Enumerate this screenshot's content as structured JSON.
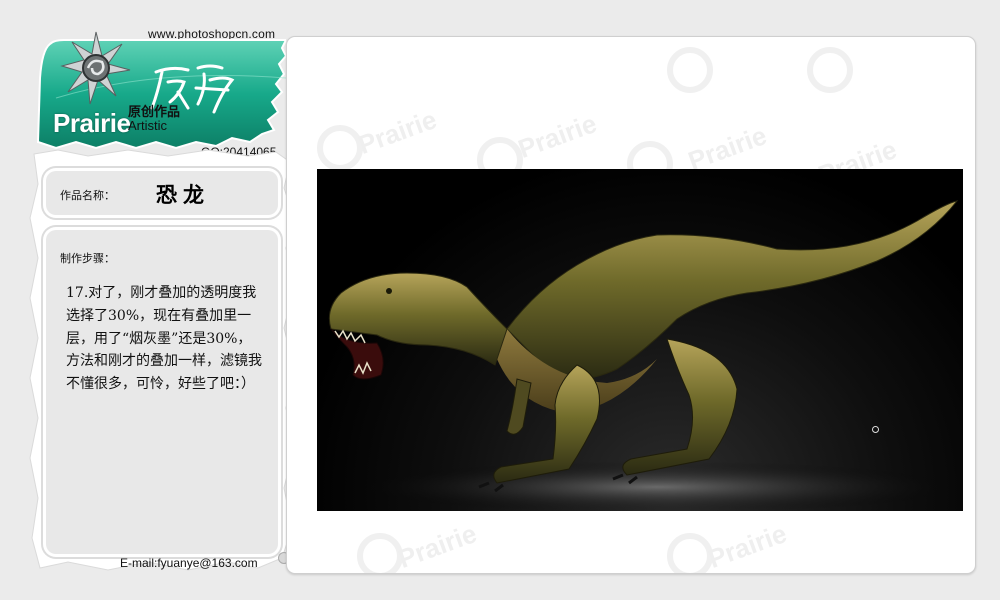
{
  "header": {
    "url": "www.photoshopcn.com",
    "logo_word": "Prairie",
    "logo_cn": "原创作品",
    "logo_en": "Artistic",
    "logo_script": "原野",
    "qq": "QQ:20414065"
  },
  "work": {
    "name_label": "作品名称：",
    "name": "恐龙"
  },
  "steps": {
    "label": "制作步骤：",
    "text": "17.对了，刚才叠加的透明度我选择了30%，现在有叠加里一层，用了“烟灰墨”还是30%，方法和刚才的叠加一样，滤镜我不懂很多，可怜，好些了吧：）"
  },
  "footer": {
    "email": "E-mail:fyuanye@163.com"
  },
  "watermark": {
    "text": "Prairie"
  },
  "colors": {
    "brand_teal": "#17a98a",
    "panel_bg": "#ffffff",
    "page_bg": "#ebebeb"
  },
  "icons": {
    "logo": "star-burst-logo-icon"
  }
}
